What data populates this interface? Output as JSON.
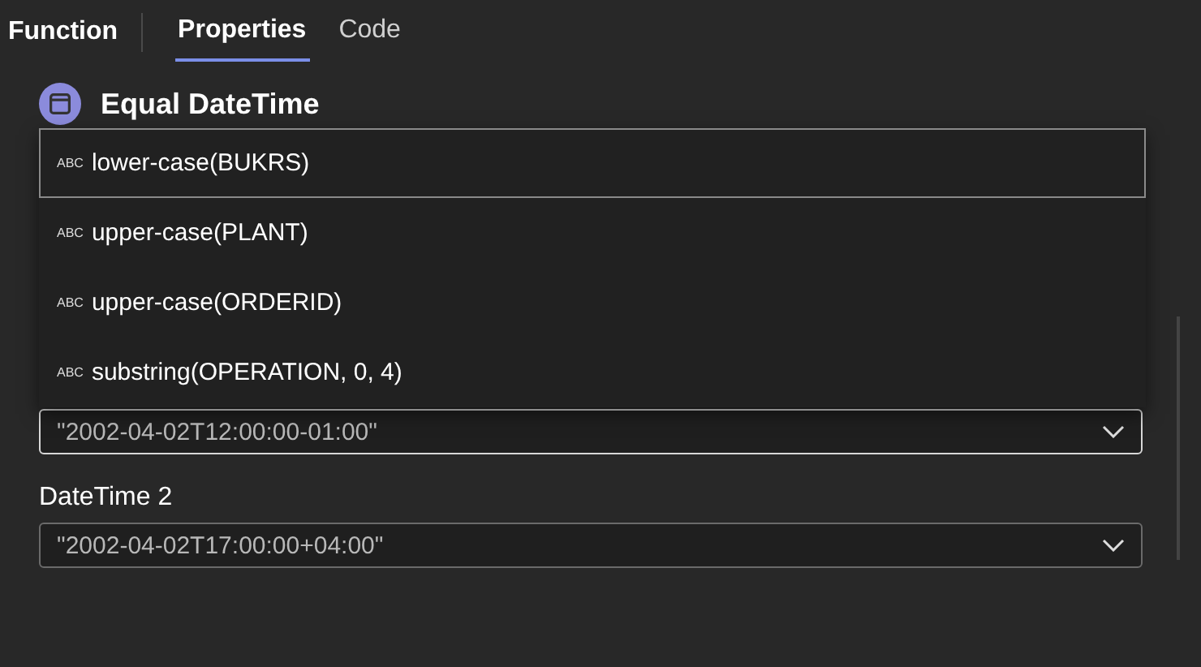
{
  "header": {
    "title": "Function",
    "tabs": [
      {
        "label": "Properties",
        "selected": true
      },
      {
        "label": "Code",
        "selected": false
      }
    ]
  },
  "function": {
    "name": "Equal DateTime"
  },
  "fields": [
    {
      "value": "\"2002-04-02T12:00:00-01:00\"",
      "focused": true
    },
    {
      "label": "DateTime 2",
      "value": "\"2002-04-02T17:00:00+04:00\"",
      "focused": false
    }
  ],
  "suggestions": {
    "input": {
      "tag": "ABC",
      "text": "lower-case(BUKRS)"
    },
    "items": [
      {
        "tag": "ABC",
        "text": "upper-case(PLANT)"
      },
      {
        "tag": "ABC",
        "text": "upper-case(ORDERID)"
      },
      {
        "tag": "ABC",
        "text": "substring(OPERATION, 0, 4)"
      }
    ]
  }
}
